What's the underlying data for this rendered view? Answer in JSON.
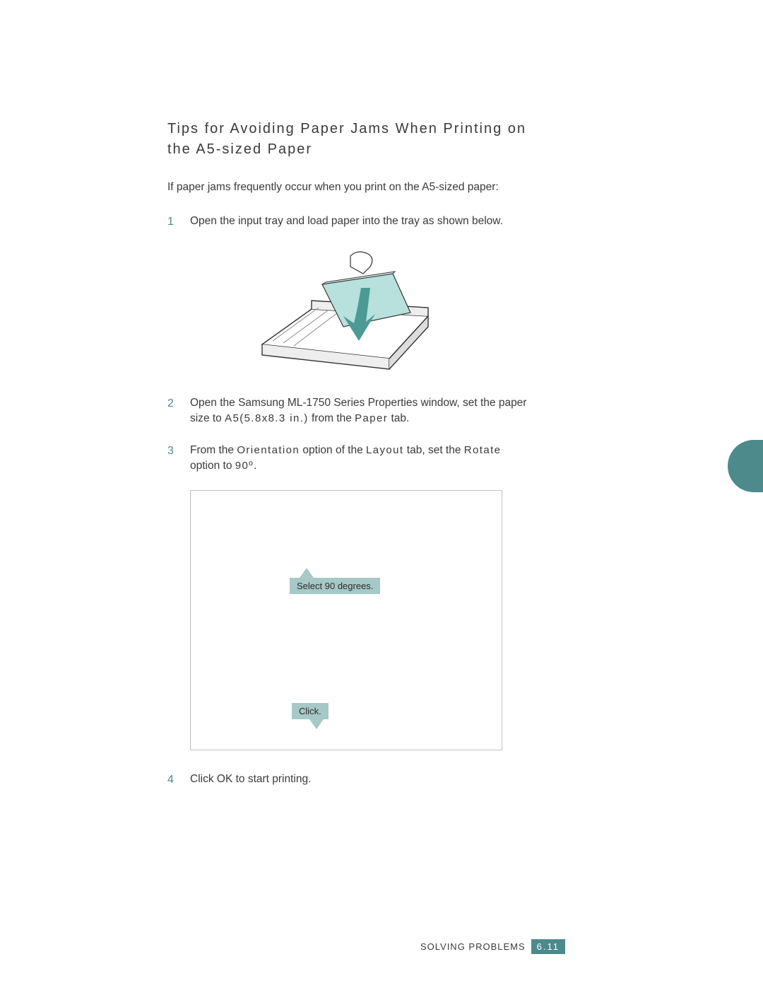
{
  "title": "Tips for Avoiding Paper Jams When Printing on the A5-sized Paper",
  "intro": "If paper jams frequently occur when you print on the A5-sized paper:",
  "steps": {
    "s1": {
      "num": "1",
      "text": "Open the input tray and load paper into the tray as shown below."
    },
    "s2": {
      "num": "2",
      "parts": {
        "a": "Open the Samsung ML-1750 Series Properties window, set the paper size to ",
        "b": "A5(5.8x8.3 in.)",
        "c": " from the ",
        "d": "Paper",
        "e": " tab."
      }
    },
    "s3": {
      "num": "3",
      "parts": {
        "a": "From the ",
        "b": "Orientation",
        "c": " option of the ",
        "d": "Layout",
        "e": " tab, set the ",
        "f": "Rotate",
        "g": " option to ",
        "h": "90º",
        "i": "."
      }
    },
    "s4": {
      "num": "4",
      "text": "Click OK to start printing."
    }
  },
  "callouts": {
    "select90": "Select 90 degrees.",
    "click": "Click."
  },
  "footer": {
    "section": "SOLVING PROBLEMS",
    "page": "6.11"
  },
  "icons": {
    "tray": "printer-tray-illustration"
  }
}
